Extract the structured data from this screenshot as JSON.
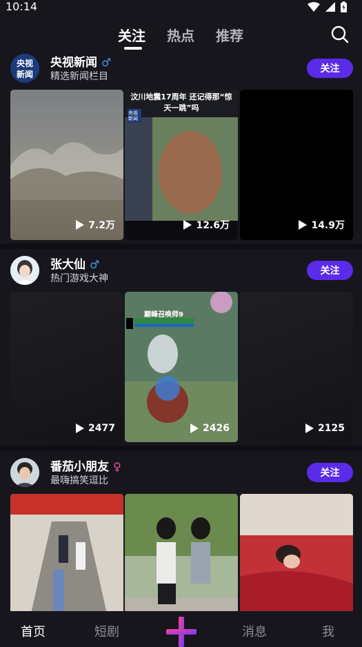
{
  "status": {
    "time": "10:14"
  },
  "tabs": [
    {
      "label": "关注",
      "active": true
    },
    {
      "label": "热点",
      "active": false
    },
    {
      "label": "推荐",
      "active": false
    }
  ],
  "feed": [
    {
      "name": "央视新闻",
      "gender": "♂",
      "gender_color": "#3b9cf0",
      "bio": "精选新闻栏目",
      "follow_label": "关注",
      "avatar_text": "央视新闻",
      "videos": [
        {
          "views": "7.2万",
          "overlay_title": ""
        },
        {
          "views": "12.6万",
          "overlay_title": "汶川地震17周年 还记得那“惊天一跳”吗",
          "overlay_badge": "央视新闻"
        },
        {
          "views": "14.9万",
          "overlay_title": ""
        }
      ]
    },
    {
      "name": "张大仙",
      "gender": "♂",
      "gender_color": "#3b9cf0",
      "bio": "热门游戏大神",
      "follow_label": "关注",
      "videos": [
        {
          "views": "2477"
        },
        {
          "views": "2426",
          "overlay_title": "巅峰召唤师9"
        },
        {
          "views": "2125"
        }
      ]
    },
    {
      "name": "番茄小朋友",
      "gender": "♀",
      "gender_color": "#ef4fa3",
      "bio": "最嗨搞笑逗比",
      "follow_label": "关注",
      "videos": [
        {
          "views": ""
        },
        {
          "views": ""
        },
        {
          "views": ""
        }
      ]
    }
  ],
  "bottom_nav": [
    {
      "label": "首页",
      "active": true
    },
    {
      "label": "短剧",
      "active": false
    },
    {
      "label": "",
      "icon": "plus-icon"
    },
    {
      "label": "消息",
      "active": false
    },
    {
      "label": "我",
      "active": false
    }
  ],
  "colors": {
    "accent": "#5b2bea",
    "background": "#17161d"
  }
}
